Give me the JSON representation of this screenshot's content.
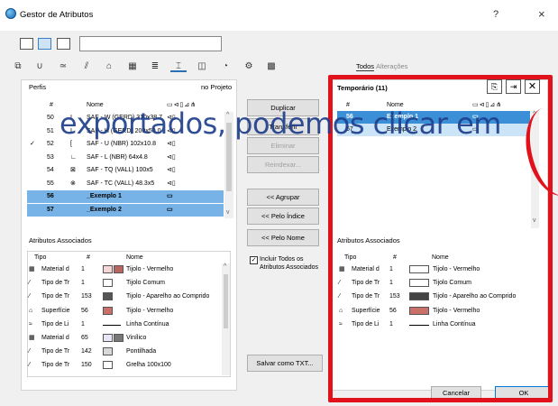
{
  "window": {
    "title": "Gestor de Atributos",
    "help": "?",
    "close": "×"
  },
  "tabs": {
    "todos": "Todos",
    "alteracoes": "Alterações"
  },
  "left": {
    "perfis": "Perfis",
    "no_projeto": "no Projeto",
    "columns": {
      "num": "#",
      "nome": "Nome"
    },
    "rows": [
      {
        "num": "50",
        "check": "",
        "icon": "I",
        "nome": "SAF - W (GERD) 310x38.7",
        "sel": false
      },
      {
        "num": "51",
        "check": "",
        "icon": "I",
        "nome": "SAF - H (GERD) 200x50.0",
        "sel": false
      },
      {
        "num": "52",
        "check": "✓",
        "icon": "[",
        "nome": "SAF - U (NBR) 102x10.8",
        "sel": false
      },
      {
        "num": "53",
        "check": "",
        "icon": "∟",
        "nome": "SAF - L (NBR) 64x4.8",
        "sel": false
      },
      {
        "num": "54",
        "check": "",
        "icon": "⊠",
        "nome": "SAF - TQ (VALL) 100x5",
        "sel": false
      },
      {
        "num": "55",
        "check": "",
        "icon": "⊗",
        "nome": "SAF - TC (VALL) 48.3x5",
        "sel": false
      },
      {
        "num": "56",
        "check": "",
        "icon": "",
        "nome": "_Exemplo 1",
        "sel": true
      },
      {
        "num": "57",
        "check": "",
        "icon": "",
        "nome": "_Exemplo 2",
        "sel": true
      }
    ],
    "associados_title": "Atributos Associados",
    "assoc_cols": {
      "tipo": "Tipo",
      "num": "#",
      "nome": "Nome"
    },
    "assoc_rows": [
      {
        "tipo": "Material d",
        "num": "1",
        "color": "#f4d6d6",
        "color2": "#b96560",
        "nome": "Tijolo - Vermelho",
        "icon": "▦"
      },
      {
        "tipo": "Tipo de Tr",
        "num": "1",
        "color": "#ffffff",
        "color2": "",
        "nome": "Tijolo Comum",
        "icon": "⁄"
      },
      {
        "tipo": "Tipo de Tr",
        "num": "153",
        "color": "#555555",
        "color2": "",
        "nome": "Tijolo - Aparelho ao Comprido",
        "icon": "⁄"
      },
      {
        "tipo": "Superfície",
        "num": "56",
        "color": "#c97068",
        "color2": "",
        "nome": "Tijolo - Vermelho",
        "icon": "⌂"
      },
      {
        "tipo": "Tipo de Li",
        "num": "1",
        "color": "",
        "color2": "",
        "nome": "Linha Contínua",
        "icon": "≈"
      },
      {
        "tipo": "Material d",
        "num": "65",
        "color": "#e6e6f6",
        "color2": "#777777",
        "nome": "Vinílico",
        "icon": "▦"
      },
      {
        "tipo": "Tipo de Tr",
        "num": "142",
        "color": "#d8d8d8",
        "color2": "",
        "nome": "Pontilhada",
        "icon": "⁄"
      },
      {
        "tipo": "Tipo de Tr",
        "num": "150",
        "color": "#ffffff",
        "color2": "",
        "nome": "Grelha 100x100",
        "icon": "⁄"
      }
    ]
  },
  "middle": {
    "duplicar": "Duplicar",
    "transferir": "Transferir",
    "eliminar": "Eliminar",
    "reindexar": "Reindexar...",
    "agrupar": "<< Agrupar",
    "pelo_indice": "<< Pelo Índice",
    "pelo_nome": "<< Pelo Nome",
    "incluir": "Incluir Todos os Atributos Associados",
    "salvar": "Salvar como TXT..."
  },
  "right": {
    "title": "Temporário (11)",
    "columns": {
      "num": "#",
      "nome": "Nome"
    },
    "rows": [
      {
        "num": "56",
        "nome": "Exemplo 1"
      },
      {
        "num": "57",
        "nome": "Exemplo 2"
      }
    ],
    "associados_title": "Atributos Associados",
    "assoc_cols": {
      "tipo": "Tipo",
      "num": "#",
      "nome": "Nome"
    },
    "assoc_rows": [
      {
        "tipo": "Material d",
        "num": "1",
        "color": "#ffffff",
        "nome": "Tijolo - Vermelho",
        "icon": "▦"
      },
      {
        "tipo": "Tipo de Tr",
        "num": "1",
        "color": "#ffffff",
        "nome": "Tijolo Comum",
        "icon": "⁄"
      },
      {
        "tipo": "Tipo de Tr",
        "num": "153",
        "color": "#444444",
        "nome": "Tijolo - Aparelho ao Comprido",
        "icon": "⁄"
      },
      {
        "tipo": "Superfície",
        "num": "56",
        "color": "#c97068",
        "nome": "Tijolo - Vermelho",
        "icon": "⌂"
      },
      {
        "tipo": "Tipo de Li",
        "num": "1",
        "color": "",
        "nome": "Linha Contínua",
        "icon": "≈"
      }
    ]
  },
  "footer": {
    "cancelar": "Cancelar",
    "ok": "OK"
  },
  "overlay": {
    "text": "exportados, podemos clicar em"
  },
  "colors": {
    "highlight": "#e1121b",
    "selection": "#77b3e6",
    "overlay_text": "#1f3f8c"
  }
}
